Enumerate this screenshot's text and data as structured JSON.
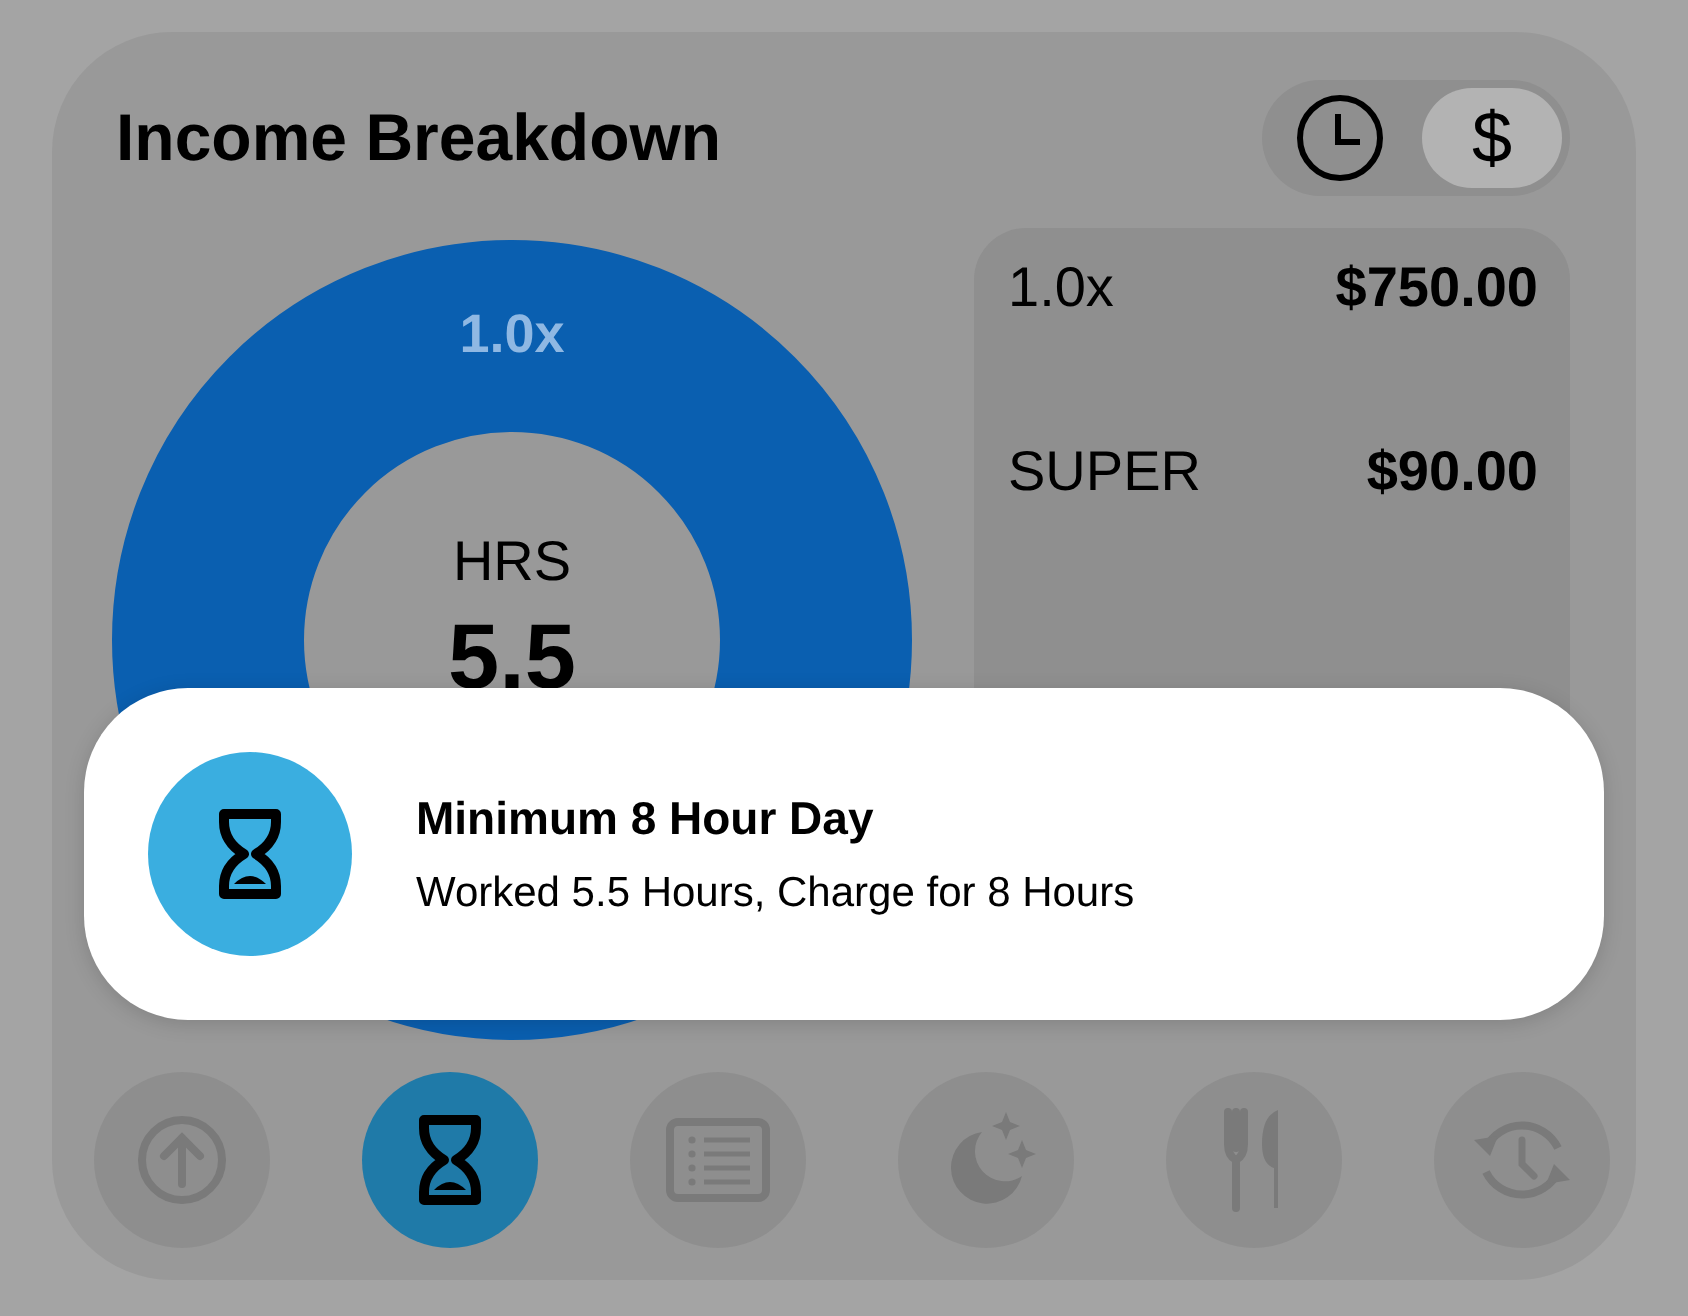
{
  "title": "Income Breakdown",
  "toggle": [
    {
      "selected": false
    },
    {
      "selected": true,
      "label": "$"
    }
  ],
  "donut": {
    "ring_label": "1.0x",
    "center_label": "HRS",
    "center_value": "5.5"
  },
  "breakdown": [
    {
      "label": "1.0x",
      "amount": "$750.00"
    },
    {
      "label": "SUPER",
      "amount": "$90.00"
    }
  ],
  "toast": {
    "title": "Minimum 8 Hour Day",
    "message": "Worked 5.5 Hours, Charge for 8 Hours"
  },
  "nav": [
    {
      "selected": false
    },
    {
      "selected": true
    },
    {
      "selected": false
    },
    {
      "selected": false
    },
    {
      "selected": false
    },
    {
      "selected": false
    }
  ]
}
